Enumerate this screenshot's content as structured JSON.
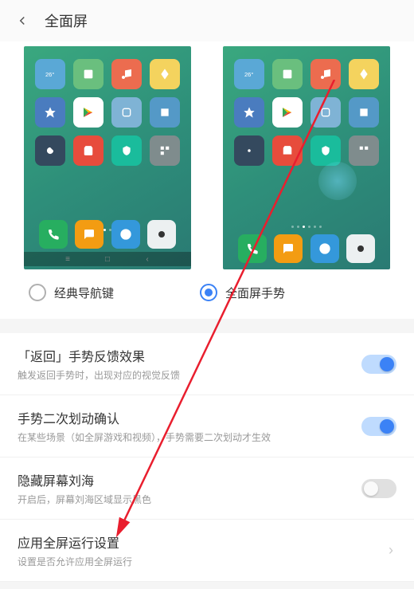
{
  "header": {
    "title": "全面屏"
  },
  "options": {
    "classic": {
      "label": "经典导航键",
      "selected": false
    },
    "gesture": {
      "label": "全面屏手势",
      "selected": true
    }
  },
  "settings": [
    {
      "title": "「返回」手势反馈效果",
      "sub": "触发返回手势时，出现对应的视觉反馈",
      "toggle": "on"
    },
    {
      "title": "手势二次划动确认",
      "sub": "在某些场景（如全屏游戏和视频），手势需要二次划动才生效",
      "toggle": "on"
    },
    {
      "title": "隐藏屏幕刘海",
      "sub": "开启后，屏幕刘海区域显示黑色",
      "toggle": "off"
    },
    {
      "title": "应用全屏运行设置",
      "sub": "设置是否允许应用全屏运行",
      "toggle": null
    }
  ]
}
